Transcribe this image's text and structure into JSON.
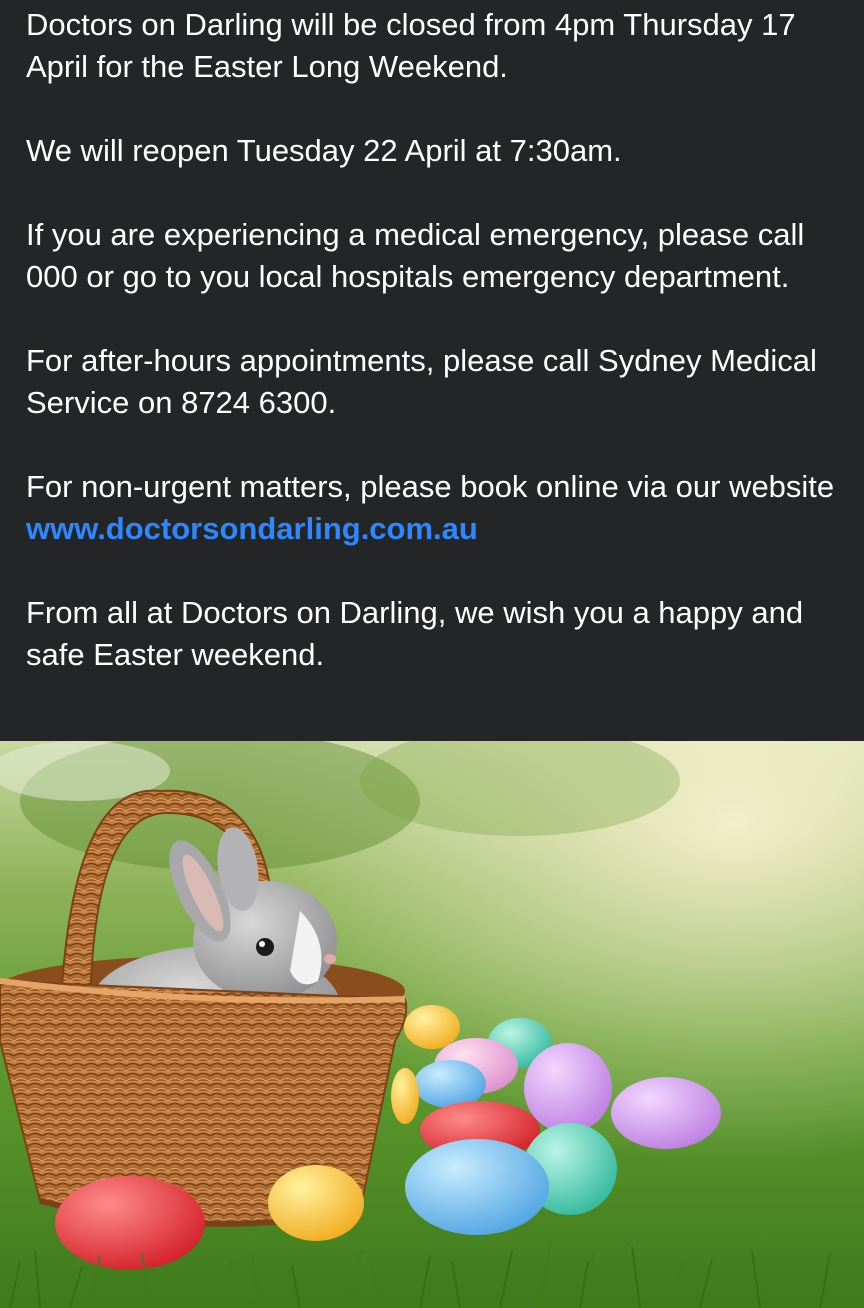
{
  "post": {
    "paragraphs": [
      "Doctors on Darling will be closed from 4pm Thursday 17 April for the Easter Long Weekend.",
      "We will reopen Tuesday 22 April at 7:30am.",
      "If you are experiencing a medical emergency, please call 000 or go to you local hospitals emergency department.",
      "For after-hours appointments, please call Sydney Medical Service on 8724 6300."
    ],
    "website_prefix": "For non-urgent matters, please book online via our website ",
    "website_link": "www.doctorsondarling.com.au",
    "closing": "From all at Doctors on Darling, we wish you a happy and safe Easter weekend."
  },
  "colors": {
    "background": "#242526",
    "text": "#ffffff",
    "link": "#2d88ff"
  },
  "image": {
    "subject": "grey bunny in a wicker basket on grass surrounded by colorful plastic Easter eggs"
  }
}
